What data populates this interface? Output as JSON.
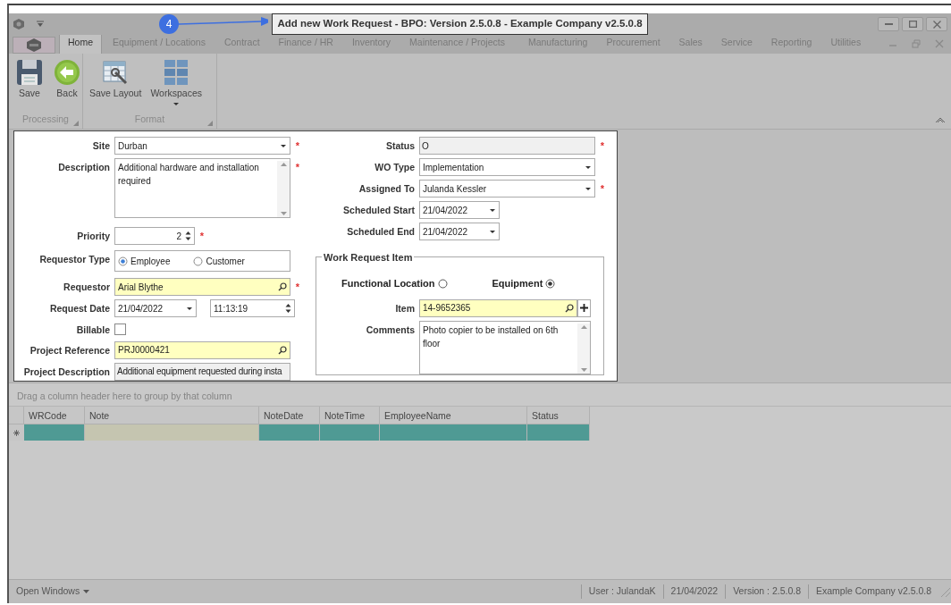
{
  "title_bar": {
    "title": "Add new Work Request - BPO: Version 2.5.0.8 - Example Company v2.5.0.8",
    "callout": "4"
  },
  "ribbon_tabs": [
    {
      "label": "Home",
      "selected": true
    },
    {
      "label": "Equipment / Locations",
      "selected": false
    },
    {
      "label": "Contract",
      "selected": false
    },
    {
      "label": "Finance / HR",
      "selected": false
    },
    {
      "label": "Inventory",
      "selected": false
    },
    {
      "label": "Maintenance / Projects",
      "selected": false
    },
    {
      "label": "Manufacturing",
      "selected": false
    },
    {
      "label": "Procurement",
      "selected": false
    },
    {
      "label": "Sales",
      "selected": false
    },
    {
      "label": "Service",
      "selected": false
    },
    {
      "label": "Reporting",
      "selected": false
    },
    {
      "label": "Utilities",
      "selected": false
    }
  ],
  "ribbon_groups": [
    {
      "caption": "Processing",
      "buttons": [
        {
          "label": "Save",
          "kind": "save"
        },
        {
          "label": "Back",
          "kind": "back"
        }
      ]
    },
    {
      "caption": "Format",
      "buttons": [
        {
          "label": "Save Layout",
          "kind": "layout"
        },
        {
          "label": "Workspaces",
          "kind": "workspaces"
        }
      ]
    }
  ],
  "form": {
    "left": [
      {
        "kind": "combo",
        "label": "Site",
        "value": "Durban",
        "required_marker": "*"
      },
      {
        "kind": "memo",
        "label": "Description",
        "value": "Additional hardware and installation required",
        "required_marker": "*"
      },
      {
        "kind": "spin",
        "label": "Priority",
        "value": "2",
        "required_marker": "*"
      },
      {
        "kind": "radio",
        "label": "Requestor Type",
        "options": [
          {
            "label": "Employee",
            "selected": true
          },
          {
            "label": "Customer",
            "selected": false
          }
        ]
      },
      {
        "kind": "lookup",
        "label": "Requestor",
        "value": "Arial Blythe",
        "required_marker": "*"
      },
      {
        "kind": "datetime",
        "label": "Request Date",
        "value": "21/04/2022",
        "time": "11:13:19"
      },
      {
        "kind": "checkbox",
        "label": "Billable",
        "checked": false
      },
      {
        "kind": "lookup",
        "label": "Project Reference",
        "value": "PRJ0000421"
      },
      {
        "kind": "readonly",
        "label": "Project Description",
        "value": "Additional equipment requested during insta"
      }
    ],
    "right": [
      {
        "kind": "readonly",
        "label": "Status",
        "value": "O",
        "required_marker": "*"
      },
      {
        "kind": "combo",
        "label": "WO Type",
        "value": "Implementation"
      },
      {
        "kind": "combo",
        "label": "Assigned To",
        "value": "Julanda Kessler",
        "required_marker": "*"
      },
      {
        "kind": "date",
        "label": "Scheduled Start",
        "value": "21/04/2022"
      },
      {
        "kind": "date",
        "label": "Scheduled End",
        "value": "21/04/2022"
      }
    ],
    "item_group": {
      "caption": "Work Request Item",
      "options": [
        {
          "label": "Functional Location",
          "selected": false
        },
        {
          "label": "Equipment",
          "selected": true
        }
      ],
      "fields": [
        {
          "kind": "lookup_add",
          "label": "Item",
          "value": "14-9652365"
        },
        {
          "kind": "memo",
          "label": "Comments",
          "value": "Photo copier to be installed on 6th floor"
        }
      ]
    }
  },
  "grid": {
    "group_hint": "Drag a column header here to group by that column",
    "columns": [
      "WRCode",
      "Note",
      "NoteDate",
      "NoteTime",
      "EmployeeName",
      "Status"
    ]
  },
  "status_bar": {
    "open_windows": "Open Windows",
    "items": [
      "User : JulandaK",
      "21/04/2022",
      "Version : 2.5.0.8",
      "Example Company v2.5.0.8"
    ]
  }
}
